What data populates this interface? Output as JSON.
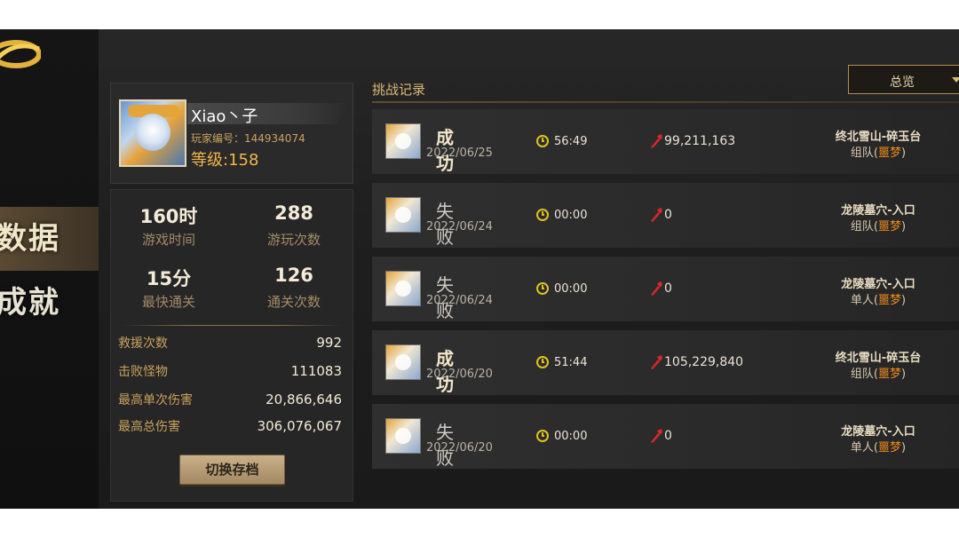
{
  "nav": {
    "items": [
      {
        "label": "数据",
        "active": true
      },
      {
        "label": "成就",
        "active": false
      }
    ]
  },
  "profile": {
    "name": "Xiao丶子",
    "player_id": "玩家编号：144934074",
    "level": "等级:158"
  },
  "stats": {
    "grid": [
      {
        "value": "160时",
        "caption": "游戏时间"
      },
      {
        "value": "288",
        "caption": "游玩次数"
      },
      {
        "value": "15分",
        "caption": "最快通关"
      },
      {
        "value": "126",
        "caption": "通关次数"
      }
    ],
    "rows": [
      {
        "label": "救援次数",
        "value": "992"
      },
      {
        "label": "击败怪物",
        "value": "111083"
      },
      {
        "label": "最高单次伤害",
        "value": "20,866,646"
      },
      {
        "label": "最高总伤害",
        "value": "306,076,067"
      }
    ],
    "switch_label": "切换存档"
  },
  "records": {
    "title": "挑战记录",
    "filter": "总览",
    "items": [
      {
        "result": "成功",
        "win": true,
        "date": "2022/06/25",
        "time": "56:49",
        "damage": "99,211,163",
        "stage": "终北雪山-碎玉台",
        "mode": "组队",
        "difficulty": "噩梦"
      },
      {
        "result": "失败",
        "win": false,
        "date": "2022/06/24",
        "time": "00:00",
        "damage": "0",
        "stage": "龙陵墓穴-入口",
        "mode": "组队",
        "difficulty": "噩梦"
      },
      {
        "result": "失败",
        "win": false,
        "date": "2022/06/24",
        "time": "00:00",
        "damage": "0",
        "stage": "龙陵墓穴-入口",
        "mode": "单人",
        "difficulty": "噩梦"
      },
      {
        "result": "成功",
        "win": true,
        "date": "2022/06/20",
        "time": "51:44",
        "damage": "105,229,840",
        "stage": "终北雪山-碎玉台",
        "mode": "组队",
        "difficulty": "噩梦"
      },
      {
        "result": "失败",
        "win": false,
        "date": "2022/06/20",
        "time": "00:00",
        "damage": "0",
        "stage": "龙陵墓穴-入口",
        "mode": "单人",
        "difficulty": "噩梦"
      }
    ]
  },
  "colors": {
    "gold": "#c9a35d",
    "highlight": "#f08a1c",
    "clock": "#e0c21f",
    "damage": "#d8282a"
  }
}
